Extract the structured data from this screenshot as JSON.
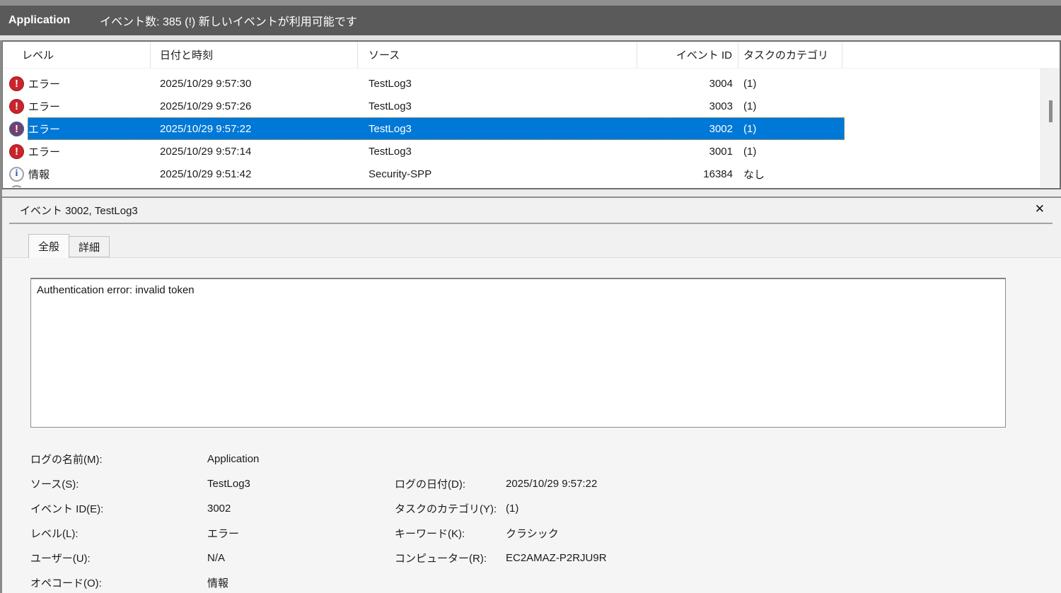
{
  "titlebar": {
    "log_name": "Application",
    "status": "イベント数: 385 (!) 新しいイベントが利用可能です"
  },
  "event_list": {
    "columns": [
      {
        "label": "レベル"
      },
      {
        "label": "日付と時刻"
      },
      {
        "label": "ソース"
      },
      {
        "label": "イベント ID"
      },
      {
        "label": "タスクのカテゴリ"
      }
    ],
    "rows": [
      {
        "icon": "error",
        "level": "エラー",
        "datetime": "2025/10/29 9:57:30",
        "source": "TestLog3",
        "event_id": "3004",
        "category": "(1)"
      },
      {
        "icon": "error",
        "level": "エラー",
        "datetime": "2025/10/29 9:57:26",
        "source": "TestLog3",
        "event_id": "3003",
        "category": "(1)"
      },
      {
        "icon": "error",
        "level": "エラー",
        "datetime": "2025/10/29 9:57:22",
        "source": "TestLog3",
        "event_id": "3002",
        "category": "(1)",
        "selected": true
      },
      {
        "icon": "error",
        "level": "エラー",
        "datetime": "2025/10/29 9:57:14",
        "source": "TestLog3",
        "event_id": "3001",
        "category": "(1)"
      },
      {
        "icon": "info",
        "level": "情報",
        "datetime": "2025/10/29 9:51:42",
        "source": "Security-SPP",
        "event_id": "16384",
        "category": "なし"
      }
    ]
  },
  "icons": {
    "error_glyph": "!",
    "info_glyph": "i",
    "close_glyph": "✕"
  },
  "colors": {
    "selection_blue": "#0078d7",
    "error_red": "#c9252c",
    "info_blue": "#2a5db0",
    "topbar_gray": "#5a5a5a"
  },
  "preview": {
    "title": "イベント 3002, TestLog3",
    "tabs": [
      {
        "label": "全般"
      },
      {
        "label": "詳細"
      }
    ],
    "message": "Authentication error: invalid token",
    "detail_rows": [
      {
        "left_label": "ログの名前(M):",
        "left_value": "Application",
        "right_label": "",
        "right_value": ""
      },
      {
        "left_label": "ソース(S):",
        "left_value": "TestLog3",
        "right_label": "ログの日付(D):",
        "right_value": "2025/10/29 9:57:22"
      },
      {
        "left_label": "イベント ID(E):",
        "left_value": "3002",
        "right_label": "タスクのカテゴリ(Y):",
        "right_value": "(1)"
      },
      {
        "left_label": "レベル(L):",
        "left_value": "エラー",
        "right_label": "キーワード(K):",
        "right_value": "クラシック"
      },
      {
        "left_label": "ユーザー(U):",
        "left_value": "N/A",
        "right_label": "コンピューター(R):",
        "right_value": "EC2AMAZ-P2RJU9R"
      },
      {
        "left_label": "オペコード(O):",
        "left_value": "情報",
        "right_label": "",
        "right_value": ""
      }
    ]
  }
}
